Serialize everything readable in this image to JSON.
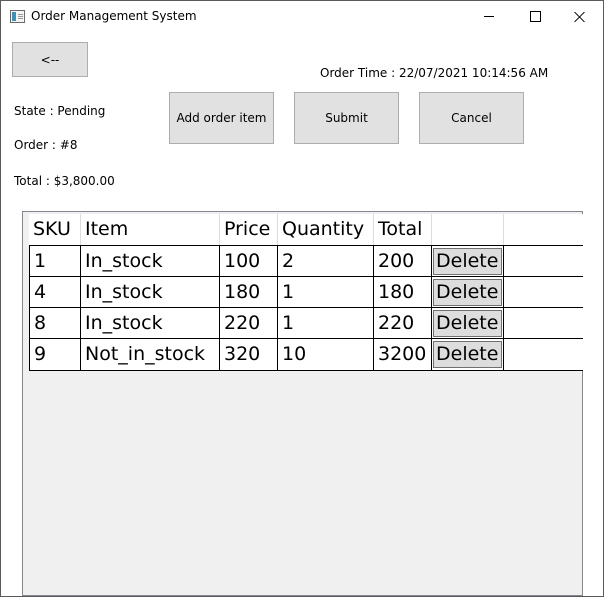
{
  "window": {
    "title": "Order Management System"
  },
  "toolbar": {
    "back_label": "<--",
    "add_label": "Add order item",
    "submit_label": "Submit",
    "cancel_label": "Cancel"
  },
  "order": {
    "time": "Order Time : 22/07/2021 10:14:56 AM",
    "state": "State : Pending",
    "number": "Order : #8",
    "total": "Total : $3,800.00"
  },
  "grid": {
    "columns": [
      "SKU",
      "Item",
      "Price",
      "Quantity",
      "Total"
    ],
    "rows": [
      {
        "sku": "1",
        "item": "In_stock",
        "price": "100",
        "quantity": "2",
        "total": "200",
        "action": "Delete"
      },
      {
        "sku": "4",
        "item": "In_stock",
        "price": "180",
        "quantity": "1",
        "total": "180",
        "action": "Delete"
      },
      {
        "sku": "8",
        "item": "In_stock",
        "price": "220",
        "quantity": "1",
        "total": "220",
        "action": "Delete"
      },
      {
        "sku": "9",
        "item": "Not_in_stock",
        "price": "320",
        "quantity": "10",
        "total": "3200",
        "action": "Delete"
      }
    ]
  },
  "icons": {
    "app": "app-window-icon",
    "minimize": "minimize-icon",
    "maximize": "maximize-icon",
    "close": "close-icon"
  }
}
